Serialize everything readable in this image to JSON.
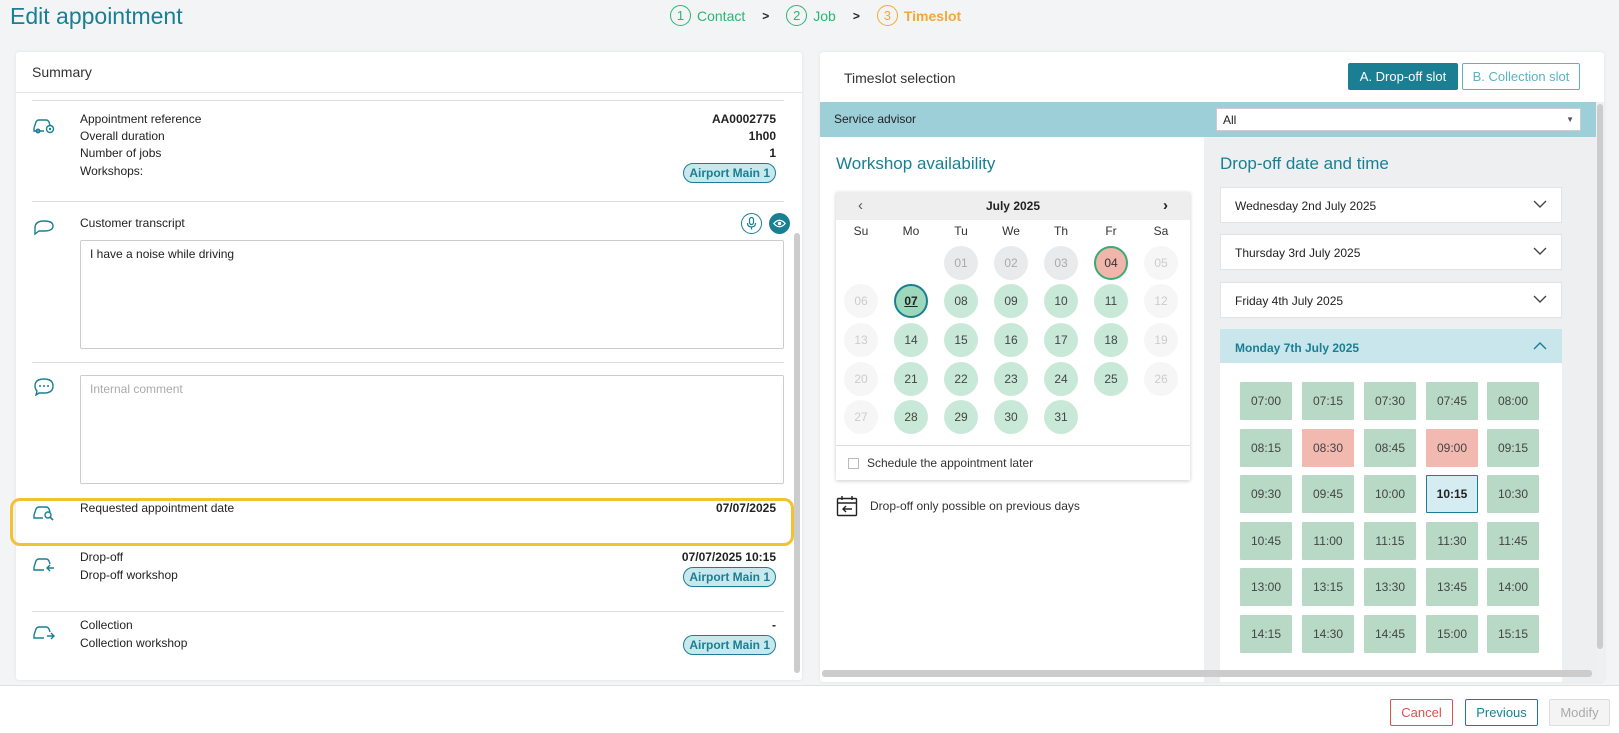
{
  "page": {
    "title": "Edit appointment"
  },
  "stepper": [
    {
      "num": "1",
      "label": "Contact"
    },
    {
      "num": "2",
      "label": "Job"
    },
    {
      "num": "3",
      "label": "Timeslot"
    }
  ],
  "stepper_separator": ">",
  "summary": {
    "title": "Summary",
    "appointment": {
      "reference_label": "Appointment reference",
      "reference_value": "AA0002775",
      "duration_label": "Overall duration",
      "duration_value": "1h00",
      "jobs_label": "Number of jobs",
      "jobs_value": "1",
      "workshops_label": "Workshops:",
      "workshop_chip": "Airport Main 1"
    },
    "transcript": {
      "label": "Customer transcript",
      "text": "I have a noise while driving"
    },
    "internal_comment": {
      "placeholder": "Internal comment"
    },
    "requested": {
      "label": "Requested appointment date",
      "value": "07/07/2025"
    },
    "dropoff": {
      "label": "Drop-off",
      "value": "07/07/2025 10:15",
      "workshop_label": "Drop-off workshop",
      "workshop_chip": "Airport Main 1"
    },
    "collection": {
      "label": "Collection",
      "value": "-",
      "workshop_label": "Collection workshop",
      "workshop_chip": "Airport Main 1"
    }
  },
  "timeslot": {
    "title": "Timeslot selection",
    "dropoff_button": "A. Drop-off slot",
    "collection_button": "B. Collection slot",
    "advisor_label": "Service advisor",
    "advisor_value": "All",
    "workshop_title": "Workshop availability",
    "calendar": {
      "month": "July 2025",
      "prev": "‹",
      "next": "›",
      "weekdays": [
        "Su",
        "Mo",
        "Tu",
        "We",
        "Th",
        "Fr",
        "Sa"
      ],
      "days": [
        {
          "d": "01",
          "s": "gr"
        },
        {
          "d": "02",
          "s": "gr"
        },
        {
          "d": "03",
          "s": "gr"
        },
        {
          "d": "04",
          "s": "full"
        },
        {
          "d": "05",
          "s": "dis"
        },
        {
          "d": "06",
          "s": "dis"
        },
        {
          "d": "07",
          "s": "sel"
        },
        {
          "d": "08",
          "s": "av"
        },
        {
          "d": "09",
          "s": "av"
        },
        {
          "d": "10",
          "s": "av"
        },
        {
          "d": "11",
          "s": "av"
        },
        {
          "d": "12",
          "s": "dis"
        },
        {
          "d": "13",
          "s": "dis"
        },
        {
          "d": "14",
          "s": "av"
        },
        {
          "d": "15",
          "s": "av"
        },
        {
          "d": "16",
          "s": "av"
        },
        {
          "d": "17",
          "s": "av"
        },
        {
          "d": "18",
          "s": "av"
        },
        {
          "d": "19",
          "s": "dis"
        },
        {
          "d": "20",
          "s": "dis"
        },
        {
          "d": "21",
          "s": "av"
        },
        {
          "d": "22",
          "s": "av"
        },
        {
          "d": "23",
          "s": "av"
        },
        {
          "d": "24",
          "s": "av"
        },
        {
          "d": "25",
          "s": "av"
        },
        {
          "d": "26",
          "s": "dis"
        },
        {
          "d": "27",
          "s": "dis"
        },
        {
          "d": "28",
          "s": "av"
        },
        {
          "d": "29",
          "s": "av"
        },
        {
          "d": "30",
          "s": "av"
        },
        {
          "d": "31",
          "s": "av"
        }
      ],
      "schedule_later_label": "Schedule the appointment later"
    },
    "dropoff_info": "Drop-off only possible on previous days",
    "dropoff_date_title": "Drop-off date and time",
    "days": [
      {
        "label": "Wednesday 2nd July 2025",
        "open": false
      },
      {
        "label": "Thursday 3rd July 2025",
        "open": false
      },
      {
        "label": "Friday 4th July 2025",
        "open": false
      },
      {
        "label": "Monday 7th July 2025",
        "open": true
      }
    ],
    "slots": [
      {
        "t": "07:00",
        "s": "av"
      },
      {
        "t": "07:15",
        "s": "av"
      },
      {
        "t": "07:30",
        "s": "av"
      },
      {
        "t": "07:45",
        "s": "av"
      },
      {
        "t": "08:00",
        "s": "av"
      },
      {
        "t": "08:15",
        "s": "av"
      },
      {
        "t": "08:30",
        "s": "busy"
      },
      {
        "t": "08:45",
        "s": "av"
      },
      {
        "t": "09:00",
        "s": "busy"
      },
      {
        "t": "09:15",
        "s": "av"
      },
      {
        "t": "09:30",
        "s": "av"
      },
      {
        "t": "09:45",
        "s": "av"
      },
      {
        "t": "10:00",
        "s": "av"
      },
      {
        "t": "10:15",
        "s": "sel"
      },
      {
        "t": "10:30",
        "s": "av"
      },
      {
        "t": "10:45",
        "s": "av"
      },
      {
        "t": "11:00",
        "s": "av"
      },
      {
        "t": "11:15",
        "s": "av"
      },
      {
        "t": "11:30",
        "s": "av"
      },
      {
        "t": "11:45",
        "s": "av"
      },
      {
        "t": "13:00",
        "s": "av"
      },
      {
        "t": "13:15",
        "s": "av"
      },
      {
        "t": "13:30",
        "s": "av"
      },
      {
        "t": "13:45",
        "s": "av"
      },
      {
        "t": "14:00",
        "s": "av"
      },
      {
        "t": "14:15",
        "s": "av"
      },
      {
        "t": "14:30",
        "s": "av"
      },
      {
        "t": "14:45",
        "s": "av"
      },
      {
        "t": "15:00",
        "s": "av"
      },
      {
        "t": "15:15",
        "s": "av"
      }
    ]
  },
  "footer": {
    "cancel": "Cancel",
    "previous": "Previous",
    "modify": "Modify"
  },
  "colors": {
    "primary": "#1a7f93",
    "success": "#2bb673",
    "active_step": "#f3a839",
    "available": "#b8d9c6",
    "busy": "#f2b9b0",
    "highlight": "#f2c230"
  }
}
